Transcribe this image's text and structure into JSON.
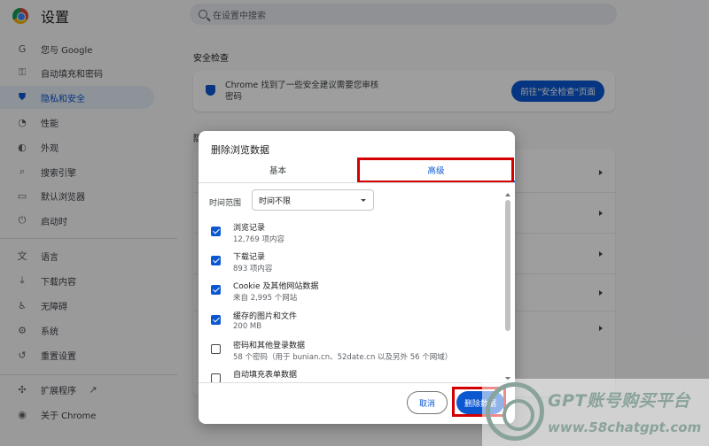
{
  "app": {
    "title": "设置"
  },
  "search": {
    "placeholder": "在设置中搜索"
  },
  "sidebar": {
    "items": [
      {
        "label": "您与 Google",
        "icon": "G"
      },
      {
        "label": "自动填充和密码",
        "icon": "⚿"
      },
      {
        "label": "隐私和安全",
        "icon": "⛊",
        "active": true
      },
      {
        "label": "性能",
        "icon": "◔"
      },
      {
        "label": "外观",
        "icon": "◐"
      },
      {
        "label": "搜索引擎",
        "icon": "⌕"
      },
      {
        "label": "默认浏览器",
        "icon": "▭"
      },
      {
        "label": "启动时",
        "icon": "⏻"
      },
      {
        "label": "语言",
        "icon": "文"
      },
      {
        "label": "下载内容",
        "icon": "⤓"
      },
      {
        "label": "无障碍",
        "icon": "♿"
      },
      {
        "label": "系统",
        "icon": "⚙"
      },
      {
        "label": "重置设置",
        "icon": "↺"
      },
      {
        "label": "扩展程序",
        "icon": "✣",
        "external_icon": "↗"
      },
      {
        "label": "关于 Chrome",
        "icon": "◉"
      }
    ]
  },
  "main": {
    "section_title": "安全检查",
    "card_text": "Chrome 找到了一些安全建议需要您审核\n密码",
    "card_button": "前往\"安全检查\"页面",
    "section2_initial": "隐"
  },
  "dialog": {
    "title": "删除浏览数据",
    "tabs": {
      "basic": "基本",
      "advanced": "高级"
    },
    "time_range_label": "时间范围",
    "time_range_value": "时间不限",
    "items": [
      {
        "title": "浏览记录",
        "subtitle": "12,769 项内容",
        "checked": true
      },
      {
        "title": "下载记录",
        "subtitle": "893 项内容",
        "checked": true
      },
      {
        "title": "Cookie 及其他网站数据",
        "subtitle": "来自 2,995 个网站",
        "checked": true
      },
      {
        "title": "缓存的图片和文件",
        "subtitle": "200 MB",
        "checked": true
      },
      {
        "title": "密码和其他登录数据",
        "subtitle": "58 个密码（用于 bunian.cn、52date.cn 以及另外 56 个网域）",
        "checked": false
      },
      {
        "title": "自动填充表单数据",
        "subtitle": "",
        "checked": false
      }
    ],
    "cancel_label": "取消",
    "delete_label": "删除数据"
  },
  "watermark": {
    "title": "GPT账号购买平台",
    "url": "www.58chatgpt.com"
  },
  "colors": {
    "accent": "#0b57d0",
    "highlight": "#d40000"
  }
}
